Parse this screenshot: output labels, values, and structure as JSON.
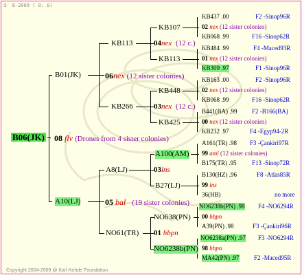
{
  "header": "$- 8-2009 ( 0: 0)",
  "footer": "Copyright 2004-2009 @ Karl Kehde Foundation.",
  "colors": {
    "accent": "#e040c0",
    "highlight": "#7ef07e",
    "root_highlight": "#4ee64e",
    "blue_text": "#0000cc",
    "red_text": "#cc0000"
  },
  "tree": {
    "root": "B06(JK)",
    "gen1": {
      "sire": "B01(JK)",
      "num": "08",
      "race": "flv",
      "note": "(Drones from 4 sister colonies)",
      "dam": "A10(LJ)"
    },
    "g2_top": {
      "sire": "KB113",
      "num": "06",
      "race": "nex",
      "note": "(12 sister colonies)",
      "dam": "KB266"
    },
    "g2_bot": {
      "sire": "A8(LJ)",
      "num": "05",
      "race": "bal",
      "note": "(19 sister colonies)",
      "dam": "NO61(TR)"
    },
    "g3": [
      {
        "sire": "KB107",
        "num": "04",
        "race": "nex",
        "note": "(12 c.)",
        "dam": "KB113"
      },
      {
        "sire": "KB448",
        "num": "03",
        "race": "nex",
        "note": "(12 c.)",
        "dam": "KB425"
      },
      {
        "sire": "A100(AM)",
        "num": "03",
        "race": "ins",
        "note": "",
        "dam": "B27(LJ)"
      },
      {
        "sire": "NO638(PN)",
        "num": "01",
        "race": "hbpn",
        "note": "",
        "dam": "NO6238b(PN)"
      }
    ],
    "g4": [
      {
        "sire": "KB437",
        "sire_score": ".00",
        "sire_info": "F2 -Sinop96R",
        "num": "02",
        "race": "nex",
        "note": "(12 sister colonies)",
        "dam": "KB068",
        "dam_score": ".99",
        "dam_info": "F16 -Sinop62R"
      },
      {
        "sire": "KB484",
        "sire_score": ".99",
        "sire_info": "F4 -Maced93R",
        "num": "01",
        "race": "nex",
        "note": "(12 sister colonies)",
        "dam": "KB309",
        "dam_score": ".97",
        "dam_info": "F1 -Sinop96R"
      },
      {
        "sire": "KB163",
        "sire_score": ".00",
        "sire_info": "F2 -Sinop96R",
        "num": "02",
        "race": "nex",
        "note": "(12 sister colonies)",
        "dam": "KB068",
        "dam_score": ".99",
        "dam_info": "F16 -Sinop62R"
      },
      {
        "sire": "B441(BA)",
        "sire_score": ".99",
        "sire_info": "F2 -B166(BA)",
        "num": "00",
        "race": "nex",
        "note": "(12 sister colonies)",
        "dam": "KB232",
        "dam_score": ".97",
        "dam_info": "F4 -Egyp94-2R"
      },
      {
        "sire": "A161(TR)",
        "sire_score": ".98",
        "sire_info": "F3 -Çankiri97R",
        "num": "99",
        "race": "aml",
        "note": "(12 sister colonies)",
        "dam": "B175(TR)",
        "dam_score": ".95",
        "dam_info": "F13 -Sinop72R"
      },
      {
        "sire": "B130(HZ)",
        "sire_score": ".96",
        "sire_info": "F8 -Atlas85R",
        "num": "99",
        "race": "ins",
        "note": "",
        "dam": "36(HB)",
        "dam_score": "",
        "dam_info": "no more"
      },
      {
        "sire": "NO6238b(PN)",
        "sire_score": ".98",
        "sire_info": "F4 -NO6294R",
        "num": "00",
        "race": "hbpn",
        "note": "",
        "dam": "A39(PN)",
        "dam_score": ".98",
        "dam_info": "F3 -Çankiri96R"
      },
      {
        "sire": "NO6238a(PN)",
        "sire_score": ".97",
        "sire_info": "F3 -NO6294R",
        "num": "98",
        "race": "hbpn",
        "note": "",
        "dam": "MA42(PN)",
        "dam_score": ".97",
        "dam_info": "F2 -Maced95R"
      }
    ]
  }
}
